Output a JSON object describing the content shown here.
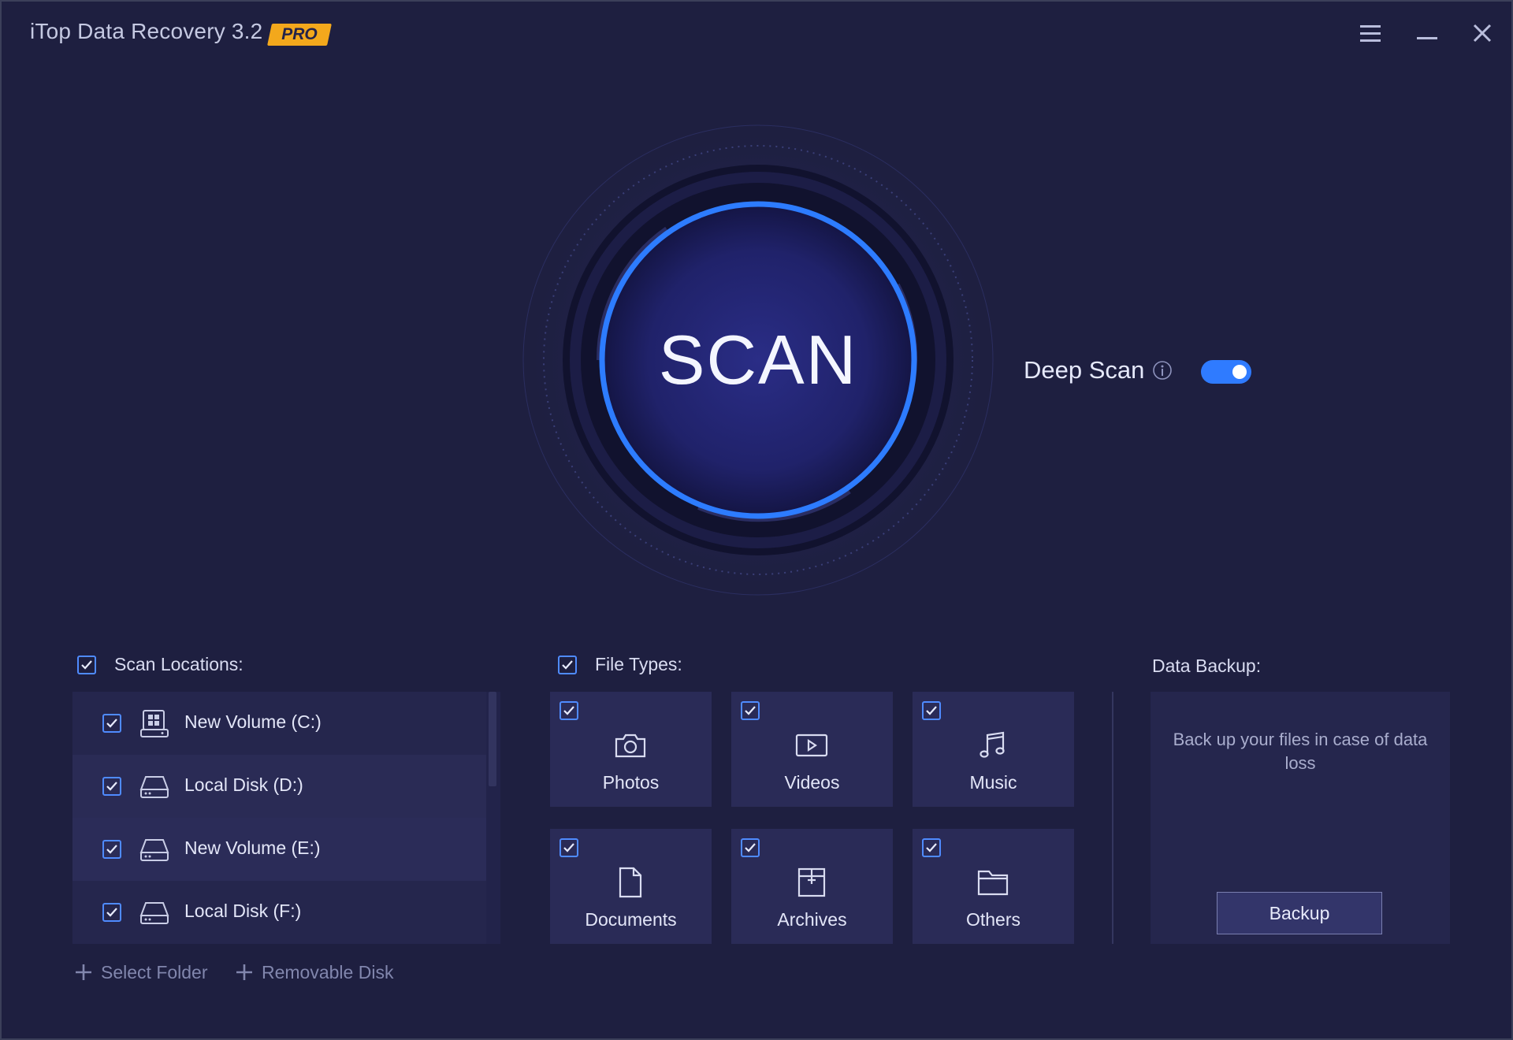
{
  "app": {
    "title": "iTop Data Recovery 3.2",
    "badge": "PRO",
    "accent_color": "#2f7bff",
    "badge_color": "#f3a81c",
    "background_color": "#1e1f40"
  },
  "window_controls": {
    "menu_icon": "hamburger-menu-icon",
    "minimize_icon": "minimize-icon",
    "close_icon": "close-icon"
  },
  "scan": {
    "button_label": "SCAN",
    "deep_scan_label": "Deep Scan",
    "deep_scan_enabled": true,
    "info_icon": "info-icon"
  },
  "locations": {
    "label": "Scan Locations:",
    "all_checked": true,
    "items": [
      {
        "name": "New Volume (C:)",
        "checked": true,
        "icon": "windows-drive-icon"
      },
      {
        "name": "Local Disk (D:)",
        "checked": true,
        "icon": "hard-drive-icon"
      },
      {
        "name": "New Volume (E:)",
        "checked": true,
        "icon": "hard-drive-icon"
      },
      {
        "name": "Local Disk (F:)",
        "checked": true,
        "icon": "hard-drive-icon"
      }
    ],
    "add_folder_label": "Select Folder",
    "add_removable_label": "Removable Disk"
  },
  "file_types": {
    "label": "File Types:",
    "all_checked": true,
    "items": [
      {
        "label": "Photos",
        "checked": true,
        "icon": "camera-icon"
      },
      {
        "label": "Videos",
        "checked": true,
        "icon": "video-icon"
      },
      {
        "label": "Music",
        "checked": true,
        "icon": "music-note-icon"
      },
      {
        "label": "Documents",
        "checked": true,
        "icon": "document-icon"
      },
      {
        "label": "Archives",
        "checked": true,
        "icon": "archive-icon"
      },
      {
        "label": "Others",
        "checked": true,
        "icon": "folder-icon"
      }
    ]
  },
  "backup": {
    "label": "Data Backup:",
    "description": "Back up your files in case of data loss",
    "button_label": "Backup"
  }
}
